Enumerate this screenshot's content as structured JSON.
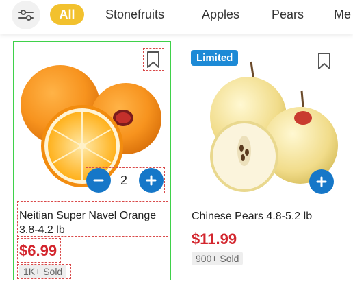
{
  "categories": {
    "active": "All",
    "items": [
      "Stonefruits",
      "Apples",
      "Pears",
      "Me"
    ]
  },
  "products": [
    {
      "name": "Neitian Super Navel Orange 3.8-4.2 lb",
      "price": "$6.99",
      "sold": "1K+ Sold",
      "quantity": "2"
    },
    {
      "badge": "Limited",
      "name": "Chinese Pears 4.8-5.2 lb",
      "price": "$11.99",
      "sold": "900+ Sold"
    }
  ],
  "colors": {
    "accent_yellow": "#f2c12e",
    "action_blue": "#1677c8",
    "price_red": "#d3262e",
    "badge_blue": "#1d8ad6",
    "selection_green": "#3fd14a"
  }
}
